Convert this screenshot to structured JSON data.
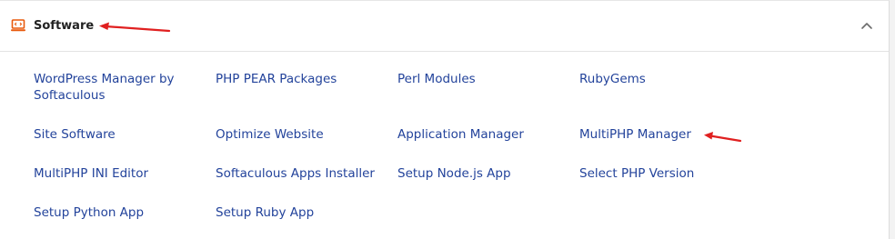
{
  "section": {
    "title": "Software",
    "icon": "software-icon",
    "collapse_icon": "chevron-up-icon",
    "accent_color": "#e8590c",
    "annotation_color": "#e02020"
  },
  "links": {
    "wordpress_manager": "WordPress Manager by Softaculous",
    "php_pear": "PHP PEAR Packages",
    "perl_modules": "Perl Modules",
    "rubygems": "RubyGems",
    "site_software": "Site Software",
    "optimize_website": "Optimize Website",
    "application_manager": "Application Manager",
    "multiphp_manager": "MultiPHP Manager",
    "multiphp_ini": "MultiPHP INI Editor",
    "softaculous_installer": "Softaculous Apps Installer",
    "setup_nodejs": "Setup Node.js App",
    "select_php": "Select PHP Version",
    "setup_python": "Setup Python App",
    "setup_ruby": "Setup Ruby App"
  }
}
